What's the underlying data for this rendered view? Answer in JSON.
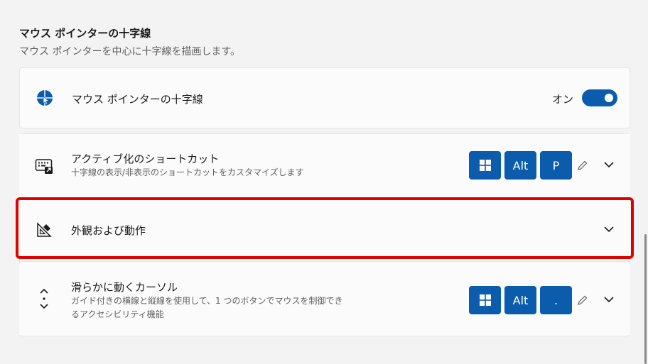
{
  "section": {
    "title": "マウス ポインターの十字線",
    "description": "マウス ポインターを中心に十字線を描画します。"
  },
  "crosshair_row": {
    "title": "マウス ポインターの十字線",
    "icon": "crosshair-pointer-icon",
    "toggle_label": "オン",
    "toggle_on": true,
    "accent": "#0b5cad"
  },
  "shortcut_row": {
    "title": "アクティブ化のショートカット",
    "description": "十字線の表示/非表示のショートカットをカスタマイズします",
    "icon": "keyboard-shortcut-icon",
    "keys": [
      "windows-key",
      "Alt",
      "P"
    ]
  },
  "appearance_row": {
    "title": "外観および動作",
    "icon": "appearance-ruler-icon"
  },
  "gliding_row": {
    "title": "滑らかに動くカーソル",
    "description_line1": "ガイド付きの横線と縦線を使用して、1 つのボタンでマウスを制御でき",
    "description_line2": "るアクセシビリティ機能",
    "icon": "gliding-cursor-icon",
    "keys": [
      "windows-key",
      "Alt",
      "."
    ]
  },
  "highlight_color": "#e00000"
}
